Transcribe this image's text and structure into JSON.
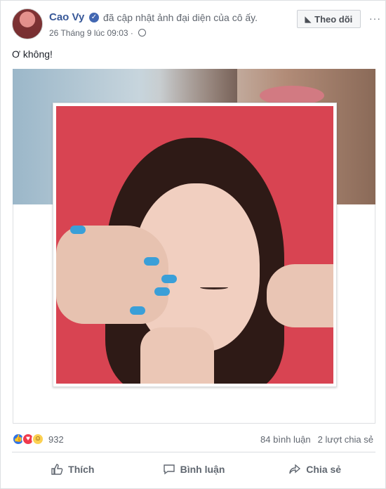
{
  "post": {
    "author": "Cao Vy",
    "action_text": "đã cập nhật ảnh đại diện của cô ấy.",
    "timestamp": "26 Tháng 9 lúc 09:03",
    "text": "Ơ không!"
  },
  "header": {
    "follow_label": "Theo dõi",
    "more_label": "···"
  },
  "reactions": {
    "count": "932",
    "types": [
      "like",
      "love",
      "haha"
    ]
  },
  "stats": {
    "comments": "84 bình luận",
    "shares": "2 lượt chia sẻ"
  },
  "actions": {
    "like": "Thích",
    "comment": "Bình luận",
    "share": "Chia sẻ"
  },
  "colors": {
    "link": "#385898",
    "accent": "#4267b2",
    "photo_bg": "#d84452",
    "nail": "#3a9fd8"
  }
}
